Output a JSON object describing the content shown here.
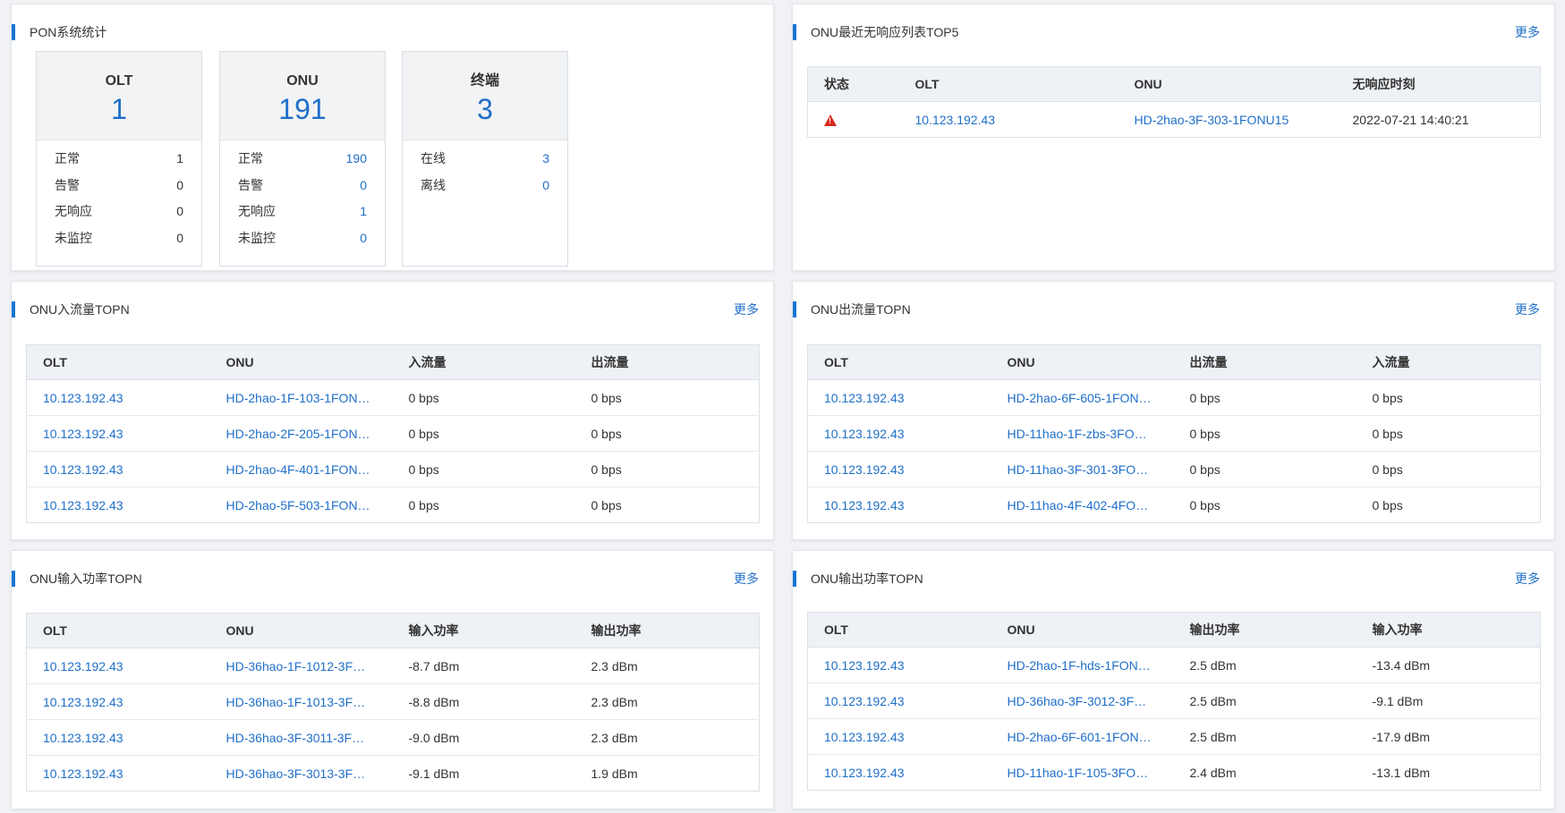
{
  "pon": {
    "title": "PON系统统计",
    "cards": [
      {
        "name": "OLT",
        "total": "1",
        "rows": [
          {
            "label": "正常",
            "value": "1"
          },
          {
            "label": "告警",
            "value": "0"
          },
          {
            "label": "无响应",
            "value": "0"
          },
          {
            "label": "未监控",
            "value": "0"
          }
        ]
      },
      {
        "name": "ONU",
        "total": "191",
        "rows": [
          {
            "label": "正常",
            "value": "190"
          },
          {
            "label": "告警",
            "value": "0"
          },
          {
            "label": "无响应",
            "value": "1"
          },
          {
            "label": "未监控",
            "value": "0"
          }
        ]
      },
      {
        "name": "终端",
        "total": "3",
        "rows": [
          {
            "label": "在线",
            "value": "3"
          },
          {
            "label": "离线",
            "value": "0"
          }
        ]
      }
    ]
  },
  "noresp": {
    "title": "ONU最近无响应列表TOP5",
    "more": "更多",
    "headers": [
      "状态",
      "OLT",
      "ONU",
      "无响应时刻"
    ],
    "rows": [
      {
        "status_icon": "warning-icon",
        "olt": "10.123.192.43",
        "onu": "HD-2hao-3F-303-1FONU15",
        "time": "2022-07-21 14:40:21"
      }
    ]
  },
  "in_traffic": {
    "title": "ONU入流量TOPN",
    "more": "更多",
    "headers": [
      "OLT",
      "ONU",
      "入流量",
      "出流量"
    ],
    "rows": [
      [
        "10.123.192.43",
        "HD-2hao-1F-103-1FON…",
        "0 bps",
        "0 bps"
      ],
      [
        "10.123.192.43",
        "HD-2hao-2F-205-1FON…",
        "0 bps",
        "0 bps"
      ],
      [
        "10.123.192.43",
        "HD-2hao-4F-401-1FON…",
        "0 bps",
        "0 bps"
      ],
      [
        "10.123.192.43",
        "HD-2hao-5F-503-1FON…",
        "0 bps",
        "0 bps"
      ]
    ]
  },
  "out_traffic": {
    "title": "ONU出流量TOPN",
    "more": "更多",
    "headers": [
      "OLT",
      "ONU",
      "出流量",
      "入流量"
    ],
    "rows": [
      [
        "10.123.192.43",
        "HD-2hao-6F-605-1FON…",
        "0 bps",
        "0 bps"
      ],
      [
        "10.123.192.43",
        "HD-11hao-1F-zbs-3FO…",
        "0 bps",
        "0 bps"
      ],
      [
        "10.123.192.43",
        "HD-11hao-3F-301-3FO…",
        "0 bps",
        "0 bps"
      ],
      [
        "10.123.192.43",
        "HD-11hao-4F-402-4FO…",
        "0 bps",
        "0 bps"
      ]
    ]
  },
  "in_power": {
    "title": "ONU输入功率TOPN",
    "more": "更多",
    "headers": [
      "OLT",
      "ONU",
      "输入功率",
      "输出功率"
    ],
    "rows": [
      [
        "10.123.192.43",
        "HD-36hao-1F-1012-3F…",
        "-8.7 dBm",
        "2.3 dBm"
      ],
      [
        "10.123.192.43",
        "HD-36hao-1F-1013-3F…",
        "-8.8 dBm",
        "2.3 dBm"
      ],
      [
        "10.123.192.43",
        "HD-36hao-3F-3011-3F…",
        "-9.0 dBm",
        "2.3 dBm"
      ],
      [
        "10.123.192.43",
        "HD-36hao-3F-3013-3F…",
        "-9.1 dBm",
        "1.9 dBm"
      ]
    ]
  },
  "out_power": {
    "title": "ONU输出功率TOPN",
    "more": "更多",
    "headers": [
      "OLT",
      "ONU",
      "输出功率",
      "输入功率"
    ],
    "rows": [
      [
        "10.123.192.43",
        "HD-2hao-1F-hds-1FON…",
        "2.5 dBm",
        "-13.4 dBm"
      ],
      [
        "10.123.192.43",
        "HD-36hao-3F-3012-3F…",
        "2.5 dBm",
        "-9.1 dBm"
      ],
      [
        "10.123.192.43",
        "HD-2hao-6F-601-1FON…",
        "2.5 dBm",
        "-17.9 dBm"
      ],
      [
        "10.123.192.43",
        "HD-11hao-1F-105-3FO…",
        "2.4 dBm",
        "-13.1 dBm"
      ]
    ]
  },
  "colors": {
    "accent": "#1677d2",
    "link": "#1f6fc9",
    "warning": "#d9251c"
  }
}
